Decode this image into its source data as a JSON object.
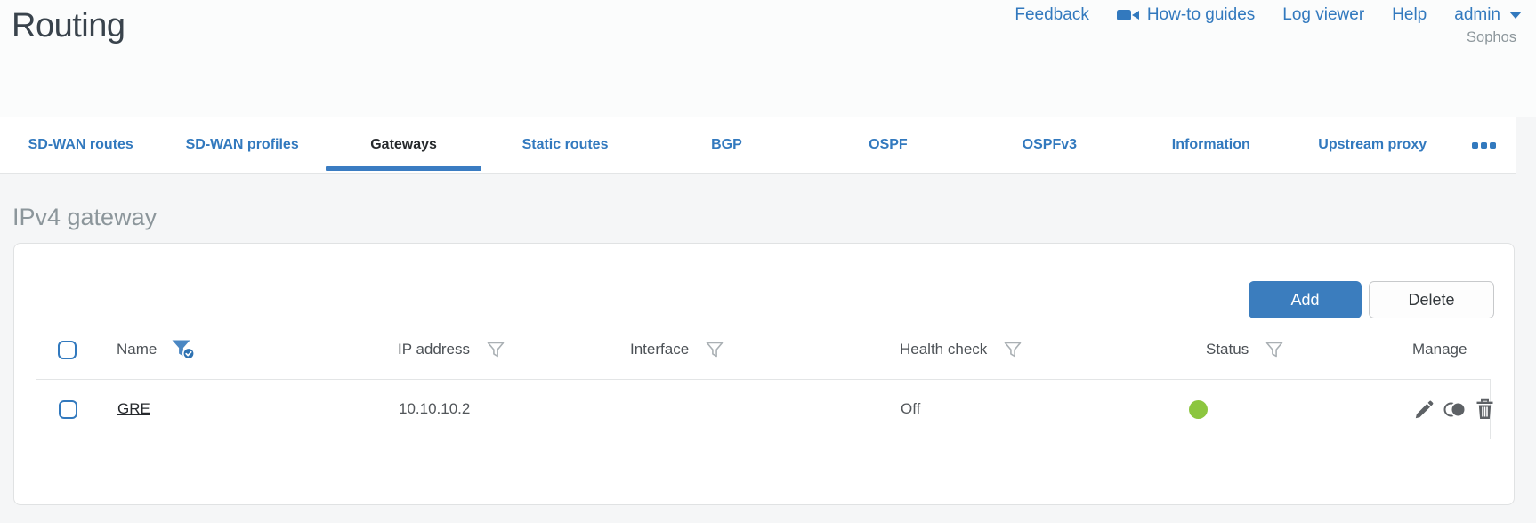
{
  "header": {
    "title": "Routing",
    "links": [
      {
        "label": "Feedback"
      },
      {
        "label": "How-to guides",
        "icon": "video-camera-icon"
      },
      {
        "label": "Log viewer"
      },
      {
        "label": "Help"
      }
    ],
    "user_menu": {
      "label": "admin",
      "icon": "caret-down-icon"
    },
    "brand": "Sophos"
  },
  "tabs": {
    "items": [
      "SD-WAN routes",
      "SD-WAN profiles",
      "Gateways",
      "Static routes",
      "BGP",
      "OSPF",
      "OSPFv3",
      "Information",
      "Upstream proxy"
    ],
    "active": "Gateways",
    "overflow_icon": "ellipsis-icon"
  },
  "content": {
    "section_heading": "IPv4 gateway",
    "toolbar": {
      "add_label": "Add",
      "delete_label": "Delete"
    },
    "table": {
      "columns": [
        {
          "label": "Name",
          "filter_icon": "filter-applied-icon"
        },
        {
          "label": "IP address",
          "filter_icon": "filter-icon"
        },
        {
          "label": "Interface",
          "filter_icon": "filter-icon"
        },
        {
          "label": "Health check",
          "filter_icon": "filter-icon"
        },
        {
          "label": "Status",
          "filter_icon": "filter-icon"
        },
        {
          "label": "Manage"
        }
      ],
      "rows": [
        {
          "name": "GRE",
          "ip_address": "10.10.10.2",
          "interface": "",
          "health_check": "Off",
          "status": "up",
          "status_color": "#8cc63f",
          "manage_icons": [
            "pencil-icon",
            "status-toggle-icon",
            "trash-icon"
          ]
        }
      ]
    }
  },
  "colors": {
    "accent_blue": "#3279be",
    "active_tab_underline": "#3a7cc2",
    "add_button_bg": "#3b7dbe",
    "status_green": "#8cc63f"
  }
}
